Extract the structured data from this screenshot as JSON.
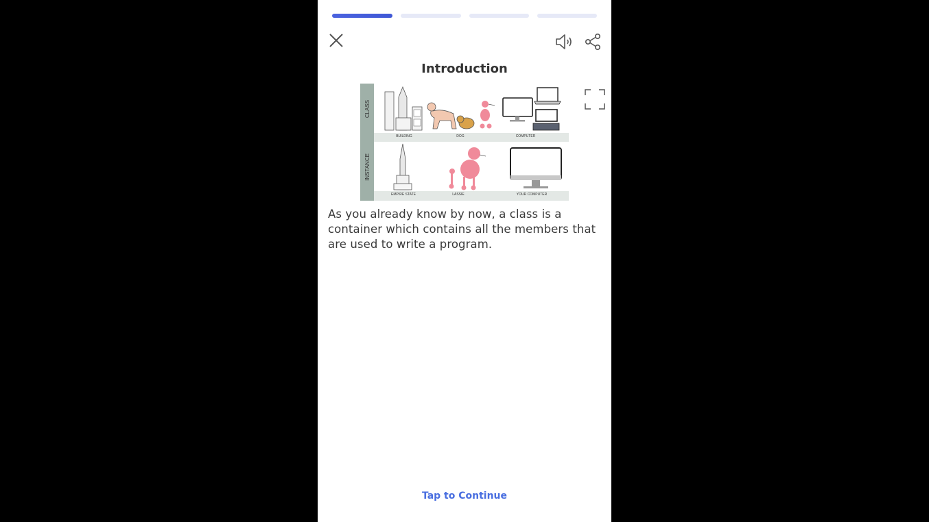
{
  "progress": {
    "segments": 4,
    "current": 1
  },
  "header": {
    "title": "Introduction"
  },
  "icons": {
    "close": "close-icon",
    "sound": "speaker-icon",
    "share": "share-icon",
    "expand": "fullscreen-icon"
  },
  "figure": {
    "row_labels": [
      "CLASS",
      "INSTANCE"
    ],
    "class_captions": [
      "BUILDING",
      "DOG",
      "COMPUTER"
    ],
    "instance_captions": [
      "EMPIRE STATE",
      "LASSIE",
      "YOUR COMPUTER"
    ]
  },
  "content": {
    "text": "As you already know by now, a class is a container which contains all the members that are used to write a program."
  },
  "footer": {
    "continue_label": "Tap to Continue"
  },
  "colors": {
    "accent": "#4a6fe0",
    "progress_active": "#4b63df",
    "progress_inactive": "#e6e9f7",
    "pink": "#f08a9a"
  }
}
